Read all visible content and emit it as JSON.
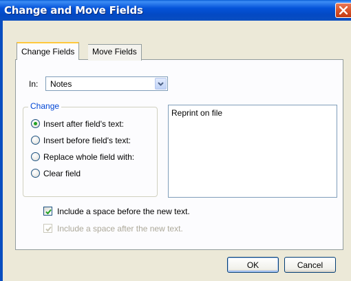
{
  "window": {
    "title": "Change and Move Fields"
  },
  "tabs": [
    {
      "label": "Change Fields",
      "selected": true
    },
    {
      "label": "Move Fields",
      "selected": false
    }
  ],
  "in_field": {
    "label": "In:",
    "value": "Notes"
  },
  "change_group": {
    "legend": "Change",
    "options": [
      {
        "label": "Insert after field's text:",
        "selected": true
      },
      {
        "label": "Insert before field's text:",
        "selected": false
      },
      {
        "label": "Replace whole field with:",
        "selected": false
      },
      {
        "label": "Clear field",
        "selected": false
      }
    ]
  },
  "text_value": "Reprint on file",
  "checkboxes": [
    {
      "label": "Include a space before the new text.",
      "checked": true,
      "enabled": true
    },
    {
      "label": "Include a space after the new text.",
      "checked": true,
      "enabled": false
    }
  ],
  "buttons": {
    "ok": "OK",
    "cancel": "Cancel"
  },
  "colors": {
    "titlebar": "#0453d8",
    "dialog_bg": "#ece9d8",
    "group_legend": "#0046d5",
    "radio_dot": "#21a121",
    "check_mark": "#21a121",
    "disabled_text": "#aca899"
  }
}
